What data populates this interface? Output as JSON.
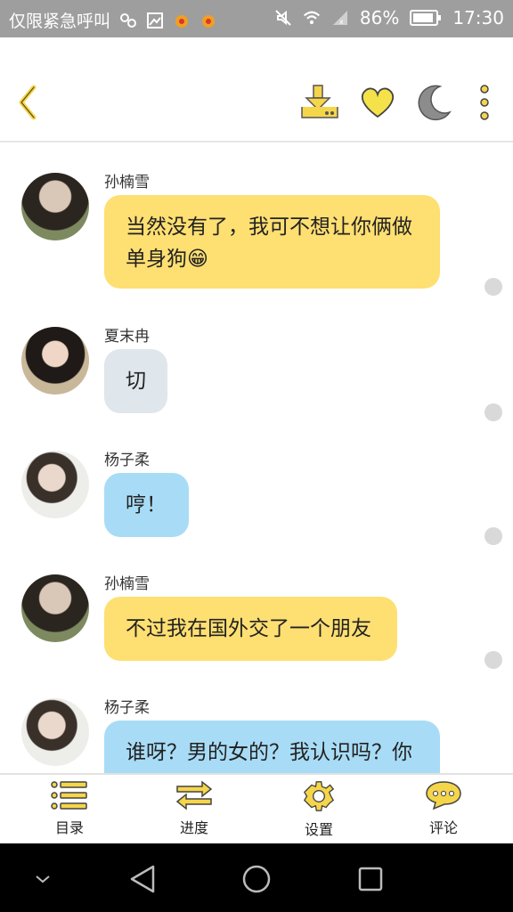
{
  "status_bar": {
    "notice": "仅限紧急呼叫",
    "battery": "86%",
    "time": "17:30"
  },
  "toolbar": {
    "back_icon": "chevron-left-icon",
    "download_icon": "download-icon",
    "favorite_icon": "heart-icon",
    "night_icon": "moon-icon",
    "more_icon": "more-vertical-icon",
    "accent": "#f5d54a"
  },
  "messages": [
    {
      "sender": "孙楠雪",
      "text": "当然没有了，我可不想让你俩做单身狗😁",
      "color": "#fedf72"
    },
    {
      "sender": "夏末冉",
      "text": "切",
      "color": "#dfe6ec"
    },
    {
      "sender": "杨子柔",
      "text": "哼！",
      "color": "#a8dcf6"
    },
    {
      "sender": "孙楠雪",
      "text": "不过我在国外交了一个朋友",
      "color": "#fedf72"
    },
    {
      "sender": "杨子柔",
      "text": "谁呀？男的女的？我认识吗？你",
      "color": "#a8dcf6"
    }
  ],
  "bottom_nav": [
    {
      "label": "目录",
      "icon": "list-icon"
    },
    {
      "label": "进度",
      "icon": "swap-arrows-icon"
    },
    {
      "label": "设置",
      "icon": "gear-icon"
    },
    {
      "label": "评论",
      "icon": "comment-icon"
    }
  ]
}
